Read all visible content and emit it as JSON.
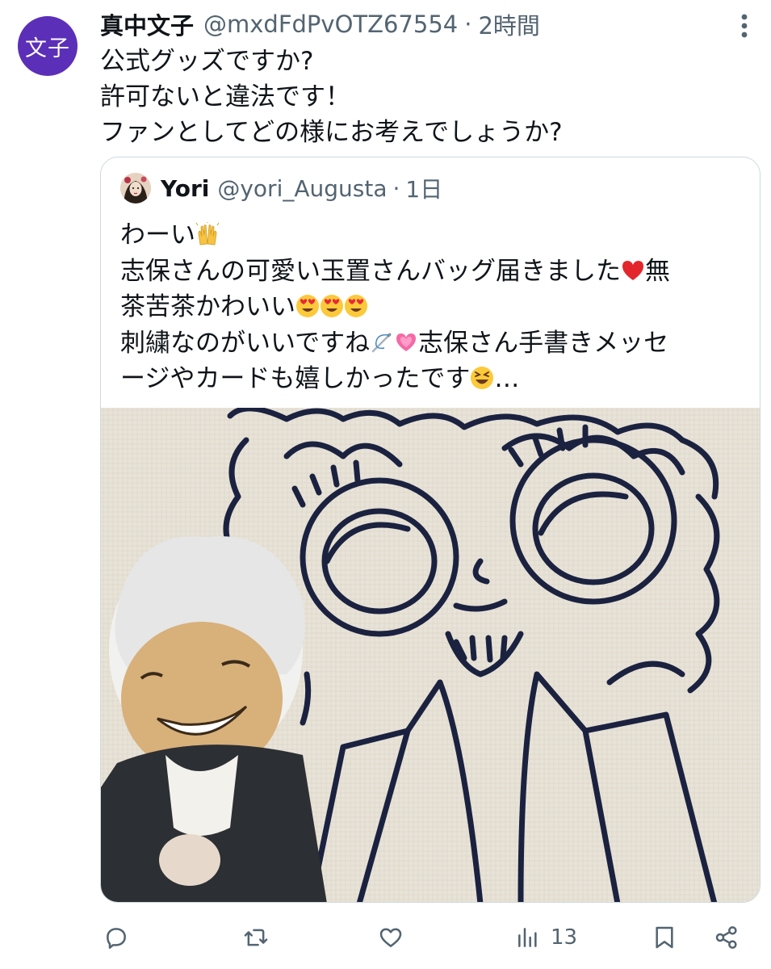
{
  "tweet": {
    "avatar_text": "文子",
    "display_name": "真中文子",
    "handle": "@mxdFdPvOTZ67554",
    "separator": "·",
    "time": "2時間",
    "lines": [
      "公式グッズですか?",
      "許可ないと違法です！",
      "ファンとしてどの様にお考えでしょうか?"
    ]
  },
  "quote": {
    "display_name": "Yori",
    "handle": "@yori_Augusta",
    "separator": "·",
    "time": "1日",
    "line1": "わーい",
    "line2": "志保さんの可愛い玉置さんバッグ届きました",
    "line2b": "無",
    "line3": "茶苦茶かわいい",
    "line4a": "刺繍なのがいいですね",
    "line4b": "志保さん手書きメッセ",
    "line5": "ージやカードも嬉しかったです",
    "line5b": "…",
    "emoji": {
      "raised_hands": "raised-hands-emoji",
      "heart": "red-heart-emoji",
      "heart_eyes": "heart-eyes-emoji",
      "needle": "sewing-needle-emoji",
      "pink_heart": "growing-heart-emoji",
      "laughing": "laughing-emoji"
    },
    "image_description_icon": "photo"
  },
  "actions": {
    "reply_icon": "reply-icon",
    "retweet_icon": "retweet-icon",
    "like_icon": "like-icon",
    "views_icon": "views-icon",
    "views_count": "13",
    "bookmark_icon": "bookmark-icon",
    "share_icon": "share-icon"
  },
  "colors": {
    "avatar_bg": "#5b2fb8",
    "secondary_text": "#536471",
    "border": "#cfd9de"
  }
}
